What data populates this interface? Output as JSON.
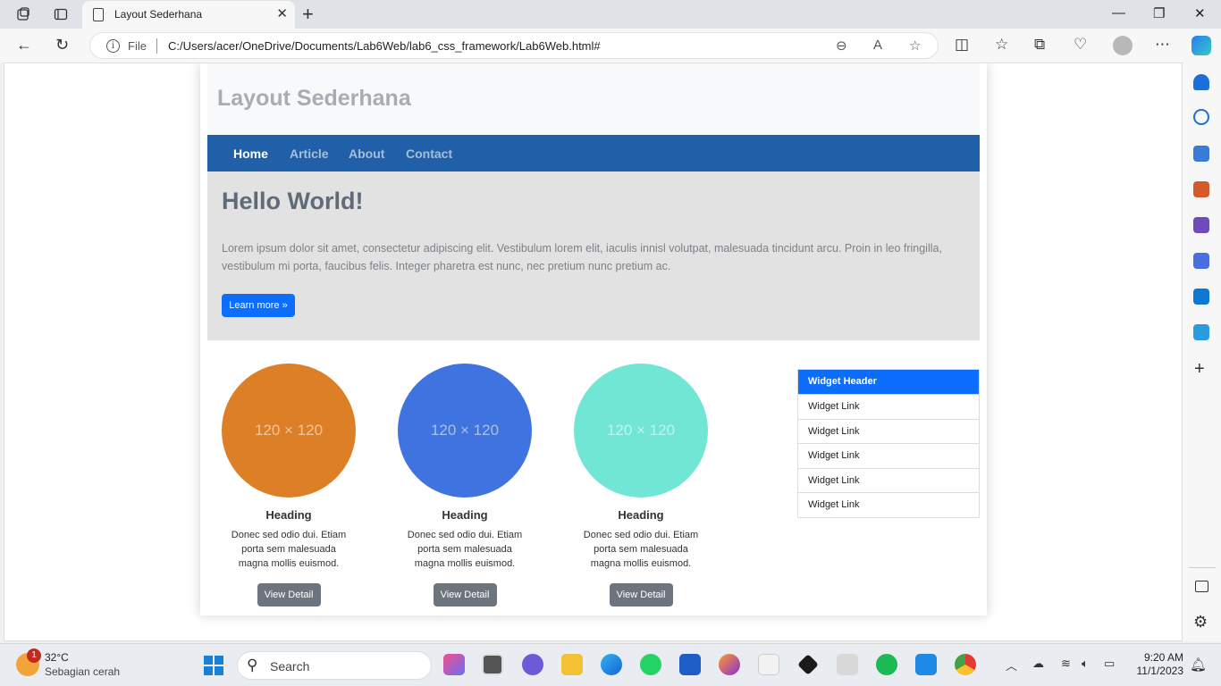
{
  "browser": {
    "tab_title": "Layout Sederhana",
    "scheme_label": "File",
    "url": "C:/Users/acer/OneDrive/Documents/Lab6Web/lab6_css_framework/Lab6Web.html#"
  },
  "page": {
    "site_title": "Layout Sederhana",
    "nav": [
      {
        "label": "Home",
        "active": true
      },
      {
        "label": "Article",
        "active": false
      },
      {
        "label": "About",
        "active": false
      },
      {
        "label": "Contact",
        "active": false
      }
    ],
    "hero": {
      "heading": "Hello World!",
      "text": "Lorem ipsum dolor sit amet, consectetur adipiscing elit. Vestibulum lorem elit, iaculis innisl volutpat, malesuada tincidunt arcu. Proin in leo fringilla, vestibulum mi porta, faucibus felis. Integer pharetra est nunc, nec pretium nunc pretium ac.",
      "button": "Learn more »"
    },
    "cards": [
      {
        "placeholder": "120 × 120",
        "color": "#dd7f26",
        "heading": "Heading",
        "text": "Donec sed odio dui. Etiam porta sem malesuada magna mollis euismod.",
        "button": "View Detail"
      },
      {
        "placeholder": "120 × 120",
        "color": "#3f73e0",
        "heading": "Heading",
        "text": "Donec sed odio dui. Etiam porta sem malesuada magna mollis euismod.",
        "button": "View Detail"
      },
      {
        "placeholder": "120 × 120",
        "color": "#72e6d5",
        "heading": "Heading",
        "text": "Donec sed odio dui. Etiam porta sem malesuada magna mollis euismod.",
        "button": "View Detail"
      }
    ],
    "widget": {
      "header": "Widget Header",
      "links": [
        "Widget Link",
        "Widget Link",
        "Widget Link",
        "Widget Link",
        "Widget Link"
      ]
    }
  },
  "taskbar": {
    "weather_temp": "32°C",
    "weather_desc": "Sebagian cerah",
    "weather_badge": "1",
    "search_label": "Search",
    "time": "9:20 AM",
    "date": "11/1/2023"
  },
  "colors": {
    "navbar": "#2060a8",
    "primary": "#0d6efd",
    "secondary": "#6c757d"
  }
}
